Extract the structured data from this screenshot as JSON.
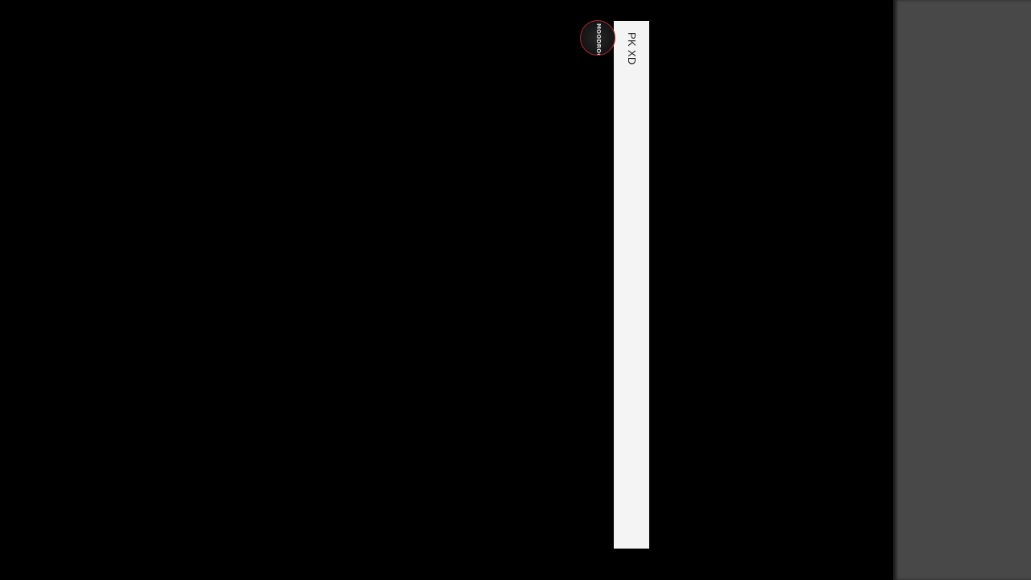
{
  "stream_panel": {
    "title": "PK XD"
  },
  "avatar": {
    "label": "MOODROOD",
    "ring_color": "#b0283c"
  },
  "colors": {
    "background": "#000000",
    "panel": "#f4f4f4",
    "side_gutter": "#484848"
  }
}
